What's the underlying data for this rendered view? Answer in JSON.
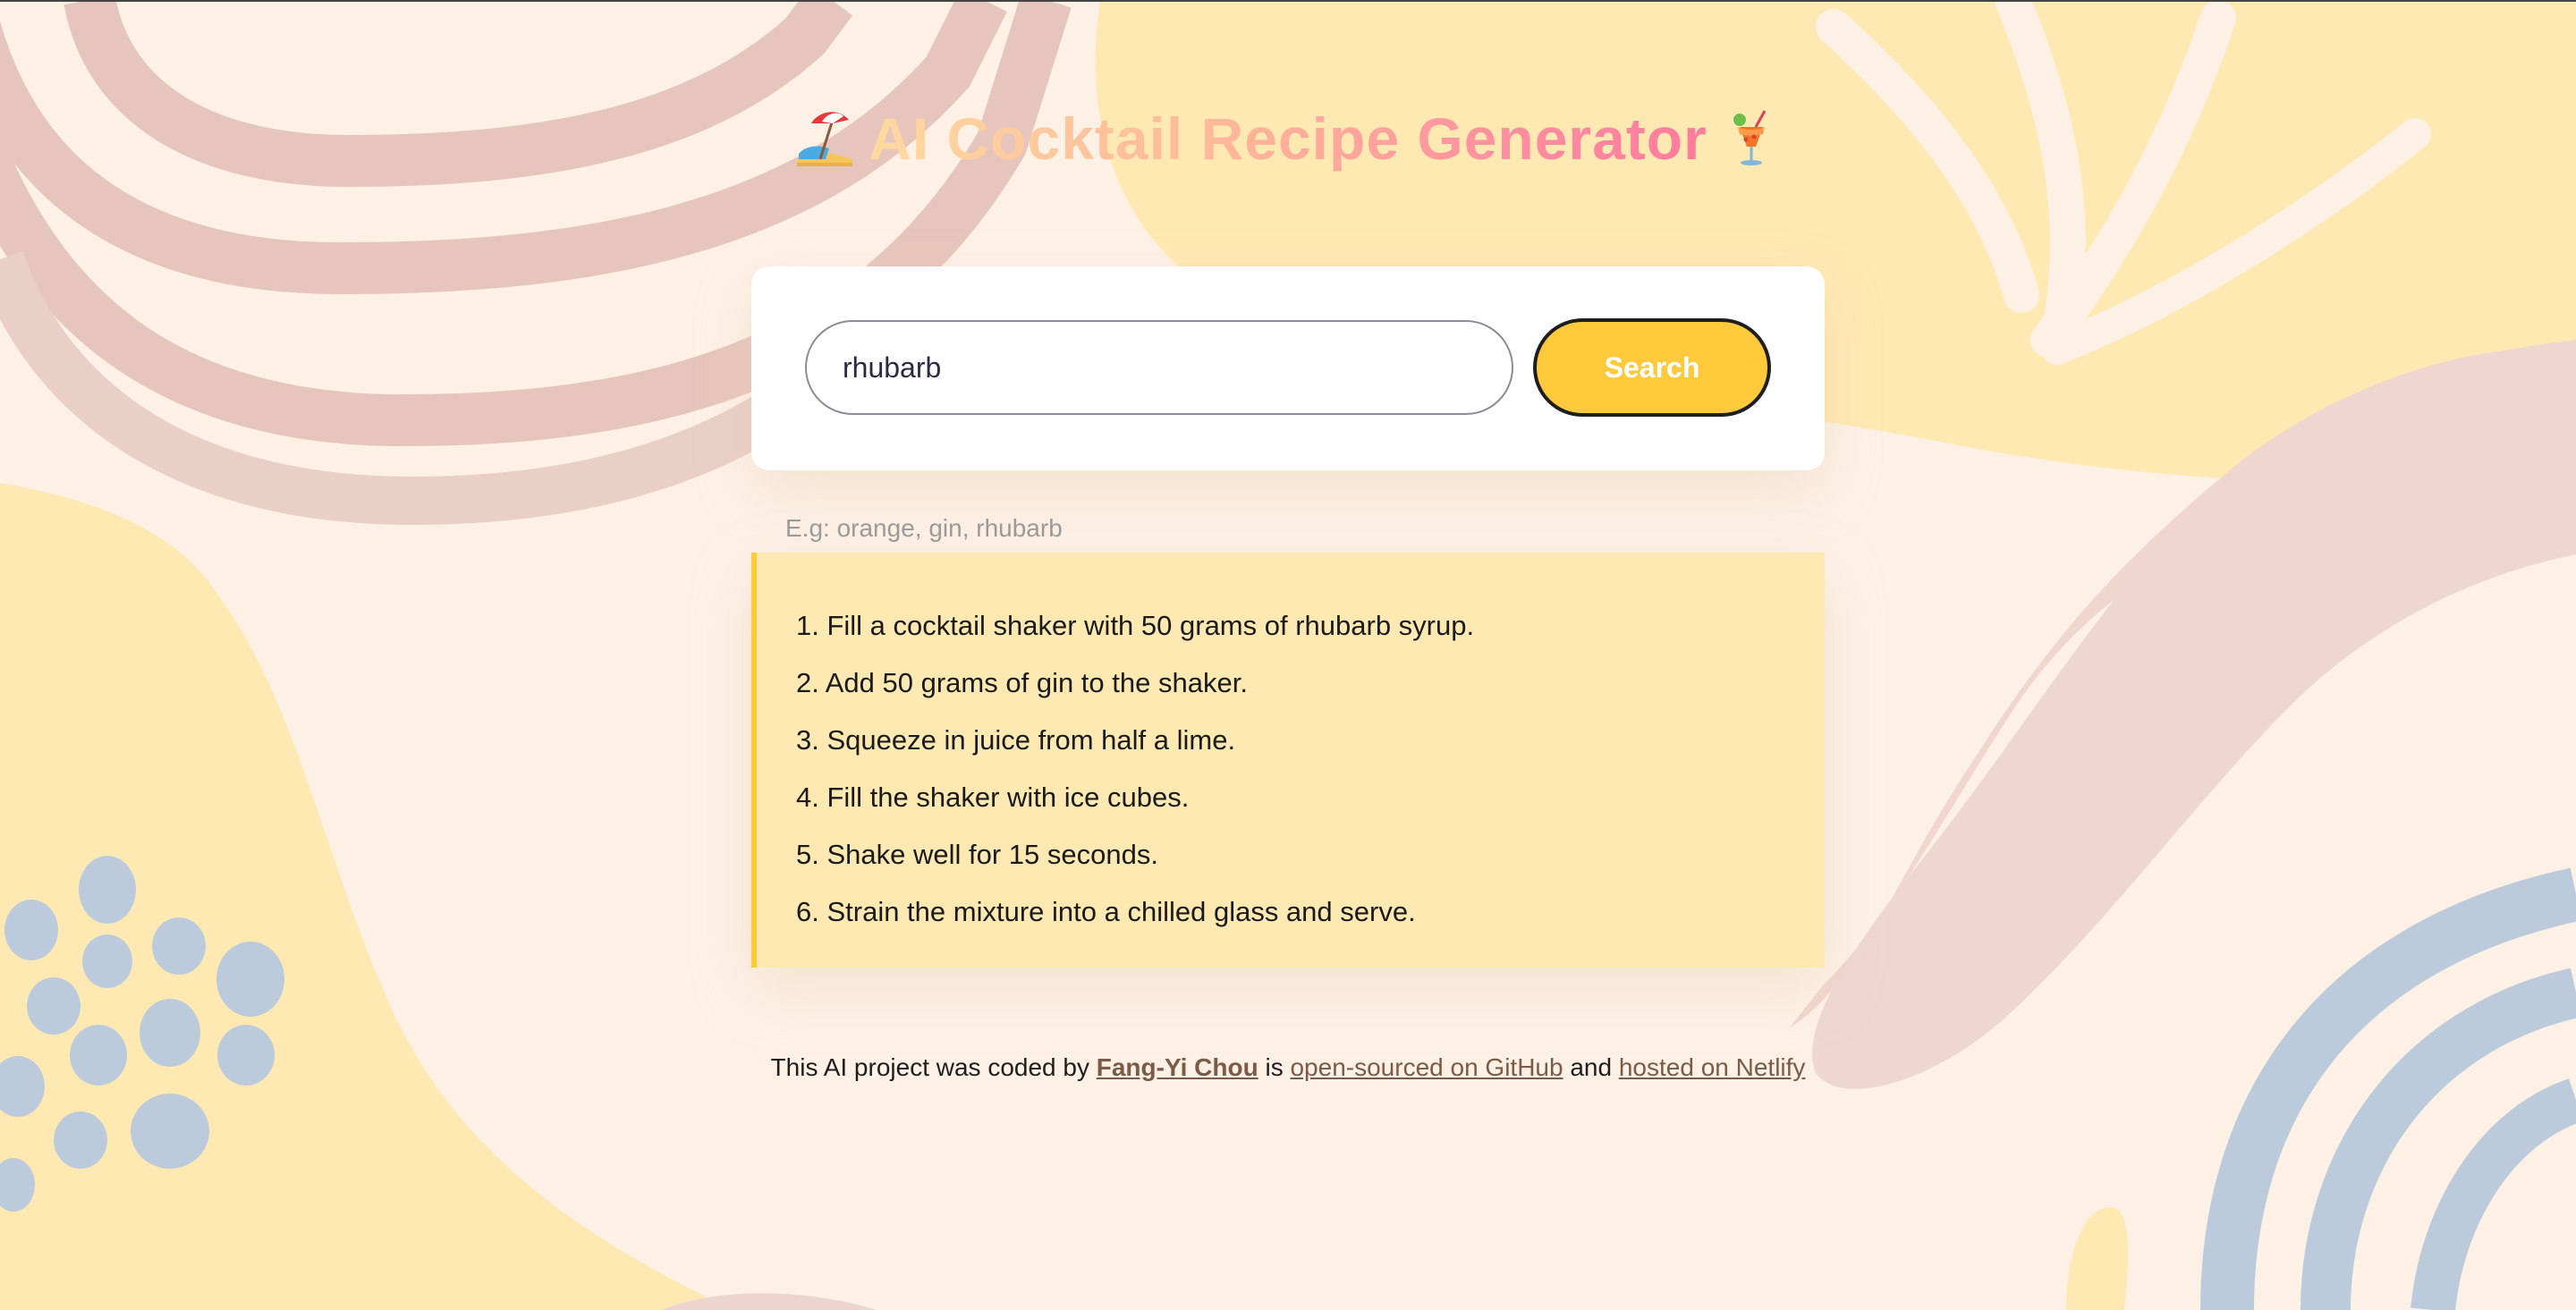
{
  "header": {
    "title": "AI Cocktail Recipe Generator",
    "left_icon": "beach-umbrella-icon",
    "right_icon": "tropical-drink-icon"
  },
  "search": {
    "value": "rhubarb",
    "placeholder": "",
    "button_label": "Search",
    "hint": "E.g: orange, gin, rhubarb"
  },
  "recipe": {
    "steps": [
      "1. Fill a cocktail shaker with 50 grams of rhubarb syrup.",
      "2. Add 50 grams of gin to the shaker.",
      "3. Squeeze in juice from half a lime.",
      "4. Fill the shaker with ice cubes.",
      "5. Shake well for 15 seconds.",
      "6. Strain the mixture into a chilled glass and serve."
    ]
  },
  "footer": {
    "prefix": "This AI project was coded by",
    "author": "Fang-Yi Chou",
    "mid1": "is",
    "github_link": "open-sourced on GitHub",
    "mid2": "and",
    "netlify_link": "hosted on Netlify"
  },
  "colors": {
    "page_background": "#fdf1e6",
    "accent_yellow": "#ffc93c",
    "recipe_background": "#ffe9b3",
    "title_gradient_start": "#ffd9a0",
    "title_gradient_end": "#ff7b9e",
    "link_brown": "#7d5a46"
  }
}
